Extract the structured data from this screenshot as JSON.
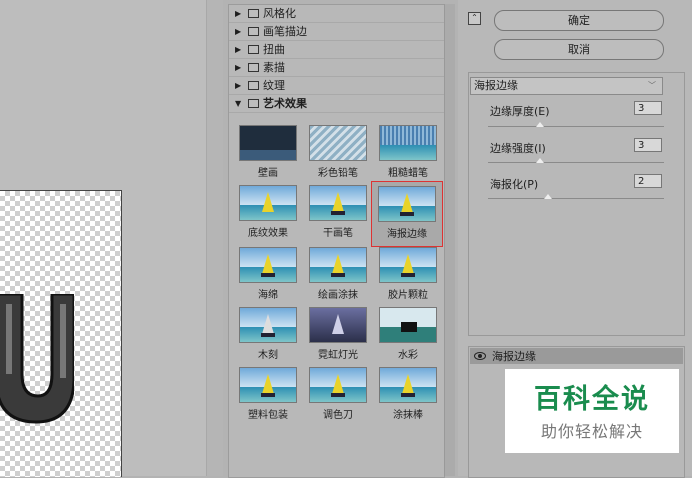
{
  "gallery": {
    "categories": [
      {
        "label": "风格化",
        "expanded": false
      },
      {
        "label": "画笔描边",
        "expanded": false
      },
      {
        "label": "扭曲",
        "expanded": false
      },
      {
        "label": "素描",
        "expanded": false
      },
      {
        "label": "纹理",
        "expanded": false
      },
      {
        "label": "艺术效果",
        "expanded": true
      }
    ],
    "thumbnails": [
      "壁画",
      "彩色铅笔",
      "粗糙蜡笔",
      "底纹效果",
      "干画笔",
      "海报边缘",
      "海绵",
      "绘画涂抹",
      "胶片颗粒",
      "木刻",
      "霓虹灯光",
      "水彩",
      "塑料包装",
      "调色刀",
      "涂抹棒"
    ],
    "selected": "海报边缘"
  },
  "buttons": {
    "ok": "确定",
    "cancel": "取消"
  },
  "filter": {
    "selected": "海报边缘",
    "params": [
      {
        "label": "边缘厚度(E)",
        "value": "3",
        "fraction": 0.3
      },
      {
        "label": "边缘强度(I)",
        "value": "3",
        "fraction": 0.3
      },
      {
        "label": "海报化(P)",
        "value": "2",
        "fraction": 0.33
      }
    ]
  },
  "layers": {
    "active": "海报边缘"
  },
  "watermark": {
    "title": "百科全说",
    "subtitle": "助你轻松解决"
  },
  "colors": {
    "selection_border": "#dd3333",
    "watermark_green": "#1a8c4e"
  }
}
